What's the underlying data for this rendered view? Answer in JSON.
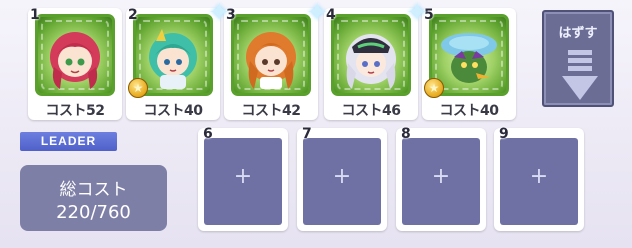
{
  "party": {
    "members": [
      {
        "slot": "1",
        "cost": "コスト52",
        "sparkle": false,
        "star": false
      },
      {
        "slot": "2",
        "cost": "コスト40",
        "sparkle": true,
        "star": true
      },
      {
        "slot": "3",
        "cost": "コスト42",
        "sparkle": true,
        "star": false
      },
      {
        "slot": "4",
        "cost": "コスト46",
        "sparkle": true,
        "star": false
      },
      {
        "slot": "5",
        "cost": "コスト40",
        "sparkle": false,
        "star": true
      }
    ],
    "empty_slots": [
      {
        "slot": "6",
        "plus": "+"
      },
      {
        "slot": "7",
        "plus": "+"
      },
      {
        "slot": "8",
        "plus": "+"
      },
      {
        "slot": "9",
        "plus": "+"
      }
    ]
  },
  "leader_label": "LEADER",
  "total_cost": {
    "label": "総コスト",
    "value": "220/760"
  },
  "remove_button": {
    "label": "はずす"
  },
  "colors": {
    "card_frame": "#5aa02c",
    "leader_bg": "#5b6dd6",
    "slot_fill": "#6f71a4",
    "panel": "#7e7fa6"
  },
  "icons": {
    "sparkle": "✦",
    "star": "★",
    "down_arrow": "down-arrow-icon"
  }
}
